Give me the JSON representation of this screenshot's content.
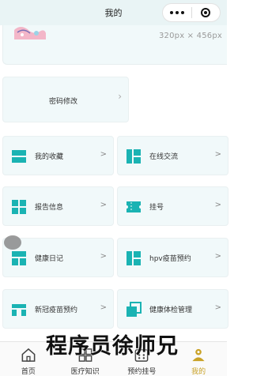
{
  "navbar": {
    "title": "我的"
  },
  "profile": {
    "size_hint": "320px × 456px"
  },
  "password_card": {
    "label": "密码修改",
    "arrow": "›"
  },
  "tiles": [
    {
      "label": "我的收藏",
      "arrow": ">",
      "icon": "favorites-icon"
    },
    {
      "label": "在线交流",
      "arrow": ">",
      "icon": "chat-icon"
    },
    {
      "label": "报告信息",
      "arrow": ">",
      "icon": "report-icon"
    },
    {
      "label": "挂号",
      "arrow": ">",
      "icon": "ticket-icon"
    },
    {
      "label": "健康日记",
      "arrow": ">",
      "icon": "diary-icon"
    },
    {
      "label": "hpv疫苗预约",
      "arrow": ">",
      "icon": "vaccine-icon"
    },
    {
      "label": "新冠疫苗预约",
      "arrow": ">",
      "icon": "covid-vaccine-icon"
    },
    {
      "label": "健康体检管理",
      "arrow": ">",
      "icon": "checkup-icon"
    }
  ],
  "tabbar": [
    {
      "label": "首页",
      "icon": "home-icon"
    },
    {
      "label": "医疗知识",
      "icon": "grid-icon"
    },
    {
      "label": "预约挂号",
      "icon": "calendar-icon"
    },
    {
      "label": "我的",
      "icon": "profile-icon",
      "active": true
    }
  ],
  "watermark": "程序员徐师兄",
  "colors": {
    "accent": "#1ab3b3",
    "active_tab": "#c9a227",
    "card_bg": "#f1f9fa"
  }
}
